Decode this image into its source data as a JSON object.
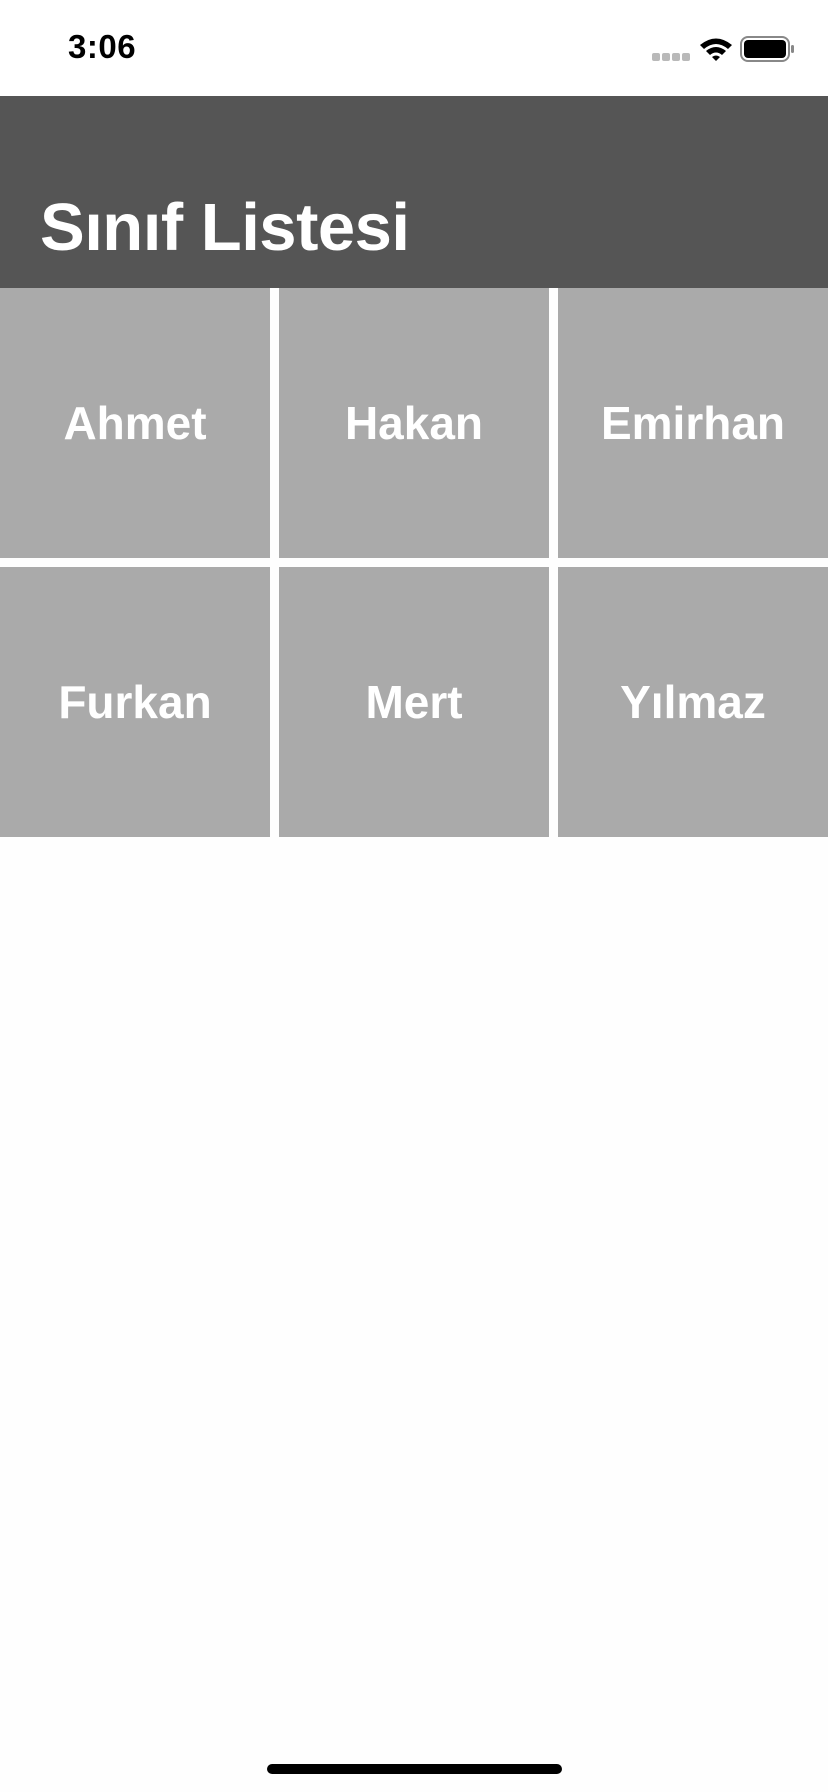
{
  "status_bar": {
    "time": "3:06",
    "icons": [
      "signal-icon",
      "wifi-icon",
      "battery-icon"
    ]
  },
  "nav": {
    "title": "Sınıf Listesi",
    "background": "#555555"
  },
  "students": [
    {
      "name": "Ahmet"
    },
    {
      "name": "Hakan"
    },
    {
      "name": "Emirhan"
    },
    {
      "name": "Furkan"
    },
    {
      "name": "Mert"
    },
    {
      "name": "Yılmaz"
    }
  ],
  "colors": {
    "cell_background": "#aaaaaa",
    "cell_text": "#ffffff",
    "page_background": "#fefefe"
  }
}
